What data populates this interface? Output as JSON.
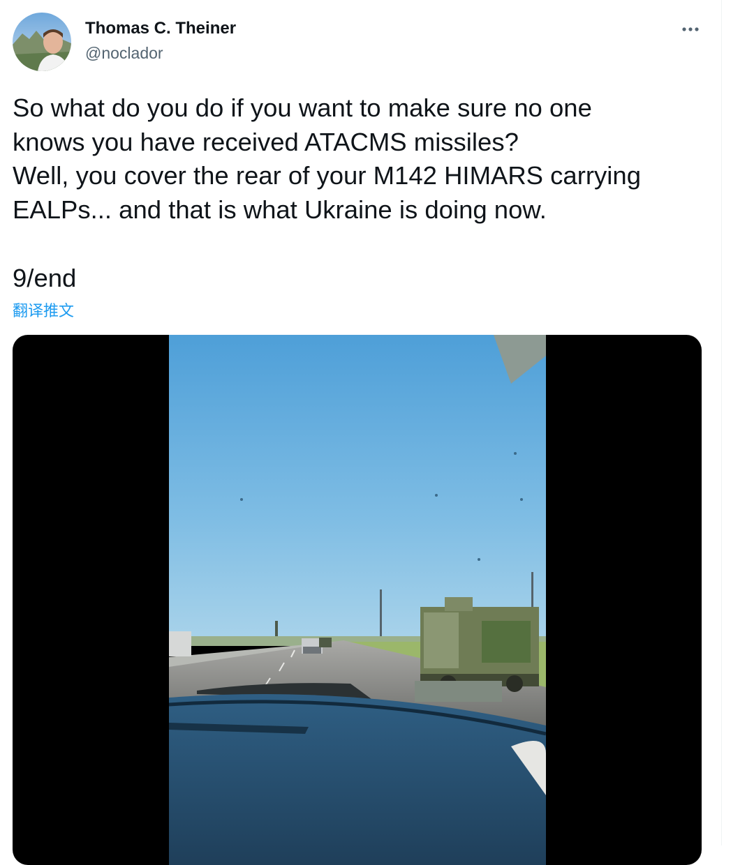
{
  "tweet": {
    "author": {
      "name": "Thomas C. Theiner",
      "handle": "@noclador"
    },
    "more_icon": "more-horizontal-icon",
    "text_lines": [
      "So what do you do if you want to make sure no one",
      "knows you have received ATACMS missiles?",
      "Well, you cover the rear of your M142 HIMARS carrying",
      "EALPs... and that is what Ukraine is doing now."
    ],
    "end_text": "9/end",
    "translate_label": "翻译推文"
  },
  "colors": {
    "text": "#0f1419",
    "secondary_text": "#536471",
    "link": "#1d9bf0",
    "media_background": "#000000"
  }
}
